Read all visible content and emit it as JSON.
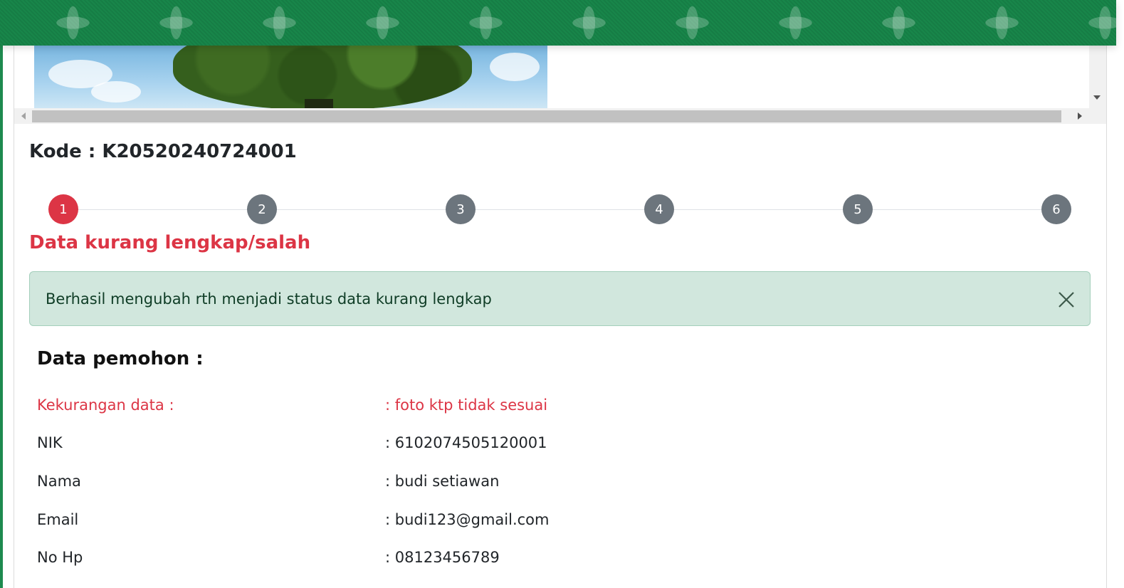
{
  "kode": {
    "label": "Kode :",
    "value": "K20520240724001"
  },
  "stepper": {
    "steps": [
      "1",
      "2",
      "3",
      "4",
      "5",
      "6"
    ],
    "active_step": 1
  },
  "status_title": "Data kurang lengkap/salah",
  "alert": {
    "message": "Berhasil mengubah rth menjadi status data kurang lengkap",
    "close_icon": "close-icon"
  },
  "section": {
    "title": "Data pemohon :"
  },
  "rows": [
    {
      "label": "Kekurangan data :",
      "value": ": foto ktp tidak sesuai"
    },
    {
      "label": "NIK",
      "value": ": 6102074505120001"
    },
    {
      "label": "Nama",
      "value": ": budi setiawan"
    },
    {
      "label": "Email",
      "value": ": budi123@gmail.com"
    },
    {
      "label": "No Hp",
      "value": ": 08123456789"
    }
  ],
  "colors": {
    "header_green": "#18864a",
    "danger": "#dc3545",
    "step_inactive": "#6c757d",
    "alert_bg": "#d1e7dd"
  }
}
